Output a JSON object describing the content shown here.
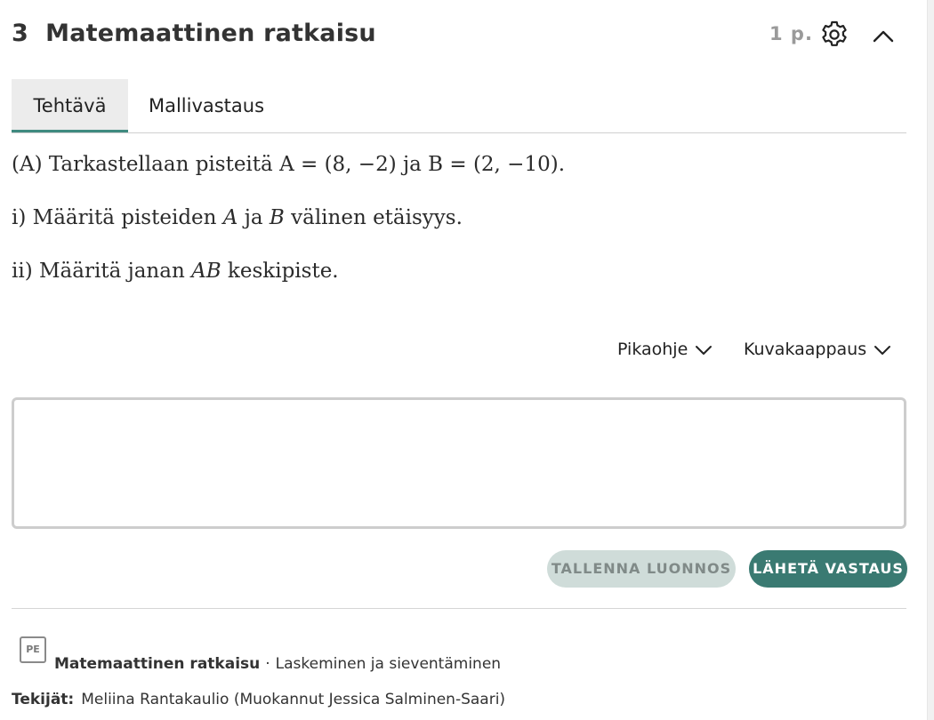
{
  "header": {
    "title": "3  Matemaattinen ratkaisu",
    "points": "1 p.",
    "settings_icon": "gear-icon",
    "collapse_icon": "chevron-up-icon"
  },
  "tabs": [
    {
      "label": "Tehtävä",
      "active": true
    },
    {
      "label": "Mallivastaus",
      "active": false
    }
  ],
  "question": {
    "a_prefix": "(A) Tarkastellaan pisteitä ",
    "a_point_a": "A = (8, −2)",
    "a_mid": " ja ",
    "a_point_b": "B = (2, −10)",
    "a_end": ".",
    "i_prefix": "i) Määritä pisteiden ",
    "i_var_a": "A",
    "i_mid": " ja ",
    "i_var_b": "B",
    "i_end": " välinen etäisyys.",
    "ii_prefix": "ii) Määritä janan ",
    "ii_var": "AB",
    "ii_end": " keskipiste."
  },
  "toolbar": {
    "quick_help": "Pikaohje",
    "screenshot": "Kuvakaappaus"
  },
  "answer": {
    "value": ""
  },
  "actions": {
    "save_draft": "TALLENNA LUONNOS",
    "submit": "LÄHETÄ VASTAUS"
  },
  "footer": {
    "badge": "PE",
    "category": "Matemaattinen ratkaisu",
    "separator": "·",
    "topic": "Laskeminen ja sieventäminen",
    "authors_label": "Tekijät:",
    "authors": "Meliina Rantakaulio (Muokannut Jessica Salminen-Saari)"
  },
  "colors": {
    "accent": "#3a7a72",
    "tab_underline": "#3f8a80",
    "draft_button": "#cfdcd9"
  }
}
